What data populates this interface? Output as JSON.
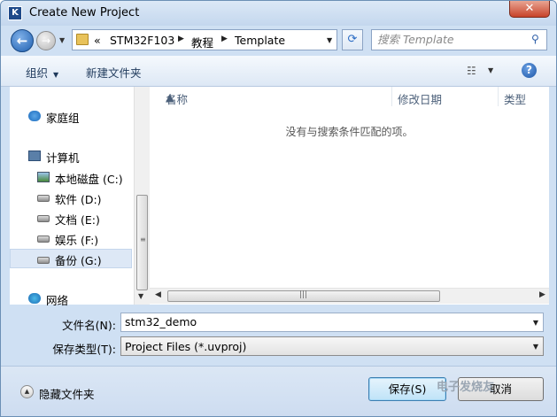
{
  "window": {
    "title": "Create New Project",
    "close_label": "✕"
  },
  "nav": {
    "back_glyph": "←",
    "forward_glyph": "→",
    "breadcrumb": [
      {
        "label": "«"
      },
      {
        "label": "STM32F103"
      },
      {
        "label": "教程"
      },
      {
        "label": "Template"
      }
    ],
    "search_placeholder": "搜索 Template"
  },
  "toolbar": {
    "organize_label": "组织",
    "new_folder_label": "新建文件夹"
  },
  "sidebar": {
    "items": [
      {
        "label": "家庭组",
        "icon": "homegroup-icon"
      },
      {
        "label": "计算机",
        "icon": "computer-icon"
      },
      {
        "label": "本地磁盘 (C:)",
        "icon": "system-drive-icon"
      },
      {
        "label": "软件 (D:)",
        "icon": "drive-icon"
      },
      {
        "label": "文档 (E:)",
        "icon": "drive-icon"
      },
      {
        "label": "娱乐 (F:)",
        "icon": "drive-icon"
      },
      {
        "label": "备份 (G:)",
        "icon": "drive-icon",
        "selected": true
      },
      {
        "label": "网络",
        "icon": "network-icon"
      }
    ]
  },
  "filelist": {
    "columns": [
      "名称",
      "修改日期",
      "类型"
    ],
    "empty_message": "没有与搜索条件匹配的项。"
  },
  "form": {
    "filename_label": "文件名(N):",
    "filename_value": "stm32_demo",
    "filetype_label": "保存类型(T):",
    "filetype_value": "Project Files (*.uvproj)"
  },
  "footer": {
    "hide_folders_label": "隐藏文件夹",
    "save_label": "保存(S)",
    "cancel_label": "取消",
    "watermark": "电子发烧友"
  },
  "colors": {
    "accent": "#3c7fb1",
    "titlebar": "#c4d7ee",
    "close": "#c8432a"
  }
}
